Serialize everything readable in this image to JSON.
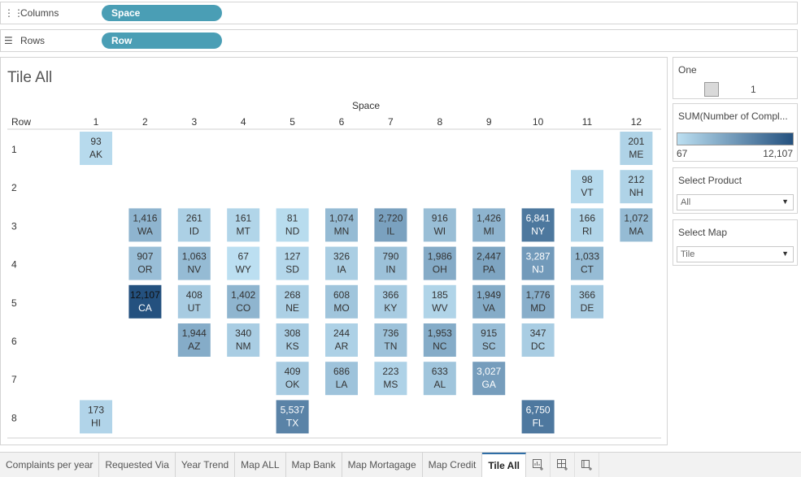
{
  "shelves": {
    "columns": {
      "label": "Columns",
      "pill": "Space"
    },
    "rows": {
      "label": "Rows",
      "pill": "Row"
    }
  },
  "view": {
    "title": "Tile All"
  },
  "legend_one": {
    "title": "One",
    "value": "1"
  },
  "color_legend": {
    "title": "SUM(Number of Compl...",
    "min": "67",
    "max": "12,107",
    "color_low": "#bcdff1",
    "color_high": "#24517f"
  },
  "select_product": {
    "title": "Select Product",
    "value": "All"
  },
  "select_map": {
    "title": "Select Map",
    "value": "Tile"
  },
  "tabs": [
    {
      "label": "Complaints per year",
      "active": false
    },
    {
      "label": "Requested Via",
      "active": false
    },
    {
      "label": "Year Trend",
      "active": false
    },
    {
      "label": "Map ALL",
      "active": false
    },
    {
      "label": "Map Bank",
      "active": false
    },
    {
      "label": "Map Mortagage",
      "active": false
    },
    {
      "label": "Map Credit",
      "active": false
    },
    {
      "label": "Tile All",
      "active": true
    }
  ],
  "tab_icons": [
    "new-worksheet-icon",
    "new-dashboard-icon",
    "new-story-icon"
  ],
  "chart_data": {
    "type": "heatmap",
    "xlabel": "Space",
    "ylabel": "Row",
    "x_categories": [
      "1",
      "2",
      "3",
      "4",
      "5",
      "6",
      "7",
      "8",
      "9",
      "10",
      "11",
      "12"
    ],
    "y_categories": [
      "1",
      "2",
      "3",
      "4",
      "5",
      "6",
      "7",
      "8"
    ],
    "color_range": [
      67,
      12107
    ],
    "tiles": [
      {
        "state": "AK",
        "col": 1,
        "row": 1,
        "value": 93
      },
      {
        "state": "ME",
        "col": 12,
        "row": 1,
        "value": 201
      },
      {
        "state": "VT",
        "col": 11,
        "row": 2,
        "value": 98
      },
      {
        "state": "NH",
        "col": 12,
        "row": 2,
        "value": 212
      },
      {
        "state": "WA",
        "col": 2,
        "row": 3,
        "value": 1416
      },
      {
        "state": "ID",
        "col": 3,
        "row": 3,
        "value": 261
      },
      {
        "state": "MT",
        "col": 4,
        "row": 3,
        "value": 161
      },
      {
        "state": "ND",
        "col": 5,
        "row": 3,
        "value": 81
      },
      {
        "state": "MN",
        "col": 6,
        "row": 3,
        "value": 1074
      },
      {
        "state": "IL",
        "col": 7,
        "row": 3,
        "value": 2720
      },
      {
        "state": "WI",
        "col": 8,
        "row": 3,
        "value": 916
      },
      {
        "state": "MI",
        "col": 9,
        "row": 3,
        "value": 1426
      },
      {
        "state": "NY",
        "col": 10,
        "row": 3,
        "value": 6841
      },
      {
        "state": "RI",
        "col": 11,
        "row": 3,
        "value": 166
      },
      {
        "state": "MA",
        "col": 12,
        "row": 3,
        "value": 1072
      },
      {
        "state": "OR",
        "col": 2,
        "row": 4,
        "value": 907
      },
      {
        "state": "NV",
        "col": 3,
        "row": 4,
        "value": 1063
      },
      {
        "state": "WY",
        "col": 4,
        "row": 4,
        "value": 67
      },
      {
        "state": "SD",
        "col": 5,
        "row": 4,
        "value": 127
      },
      {
        "state": "IA",
        "col": 6,
        "row": 4,
        "value": 326
      },
      {
        "state": "IN",
        "col": 7,
        "row": 4,
        "value": 790
      },
      {
        "state": "OH",
        "col": 8,
        "row": 4,
        "value": 1986
      },
      {
        "state": "PA",
        "col": 9,
        "row": 4,
        "value": 2447
      },
      {
        "state": "NJ",
        "col": 10,
        "row": 4,
        "value": 3287
      },
      {
        "state": "CT",
        "col": 11,
        "row": 4,
        "value": 1033
      },
      {
        "state": "CA",
        "col": 2,
        "row": 5,
        "value": 12107
      },
      {
        "state": "UT",
        "col": 3,
        "row": 5,
        "value": 408
      },
      {
        "state": "CO",
        "col": 4,
        "row": 5,
        "value": 1402
      },
      {
        "state": "NE",
        "col": 5,
        "row": 5,
        "value": 268
      },
      {
        "state": "MO",
        "col": 6,
        "row": 5,
        "value": 608
      },
      {
        "state": "KY",
        "col": 7,
        "row": 5,
        "value": 366
      },
      {
        "state": "WV",
        "col": 8,
        "row": 5,
        "value": 185
      },
      {
        "state": "VA",
        "col": 9,
        "row": 5,
        "value": 1949
      },
      {
        "state": "MD",
        "col": 10,
        "row": 5,
        "value": 1776
      },
      {
        "state": "DE",
        "col": 11,
        "row": 5,
        "value": 366
      },
      {
        "state": "AZ",
        "col": 3,
        "row": 6,
        "value": 1944
      },
      {
        "state": "NM",
        "col": 4,
        "row": 6,
        "value": 340
      },
      {
        "state": "KS",
        "col": 5,
        "row": 6,
        "value": 308
      },
      {
        "state": "AR",
        "col": 6,
        "row": 6,
        "value": 244
      },
      {
        "state": "TN",
        "col": 7,
        "row": 6,
        "value": 736
      },
      {
        "state": "NC",
        "col": 8,
        "row": 6,
        "value": 1953
      },
      {
        "state": "SC",
        "col": 9,
        "row": 6,
        "value": 915
      },
      {
        "state": "DC",
        "col": 10,
        "row": 6,
        "value": 347
      },
      {
        "state": "OK",
        "col": 5,
        "row": 7,
        "value": 409
      },
      {
        "state": "LA",
        "col": 6,
        "row": 7,
        "value": 686
      },
      {
        "state": "MS",
        "col": 7,
        "row": 7,
        "value": 223
      },
      {
        "state": "AL",
        "col": 8,
        "row": 7,
        "value": 633
      },
      {
        "state": "GA",
        "col": 9,
        "row": 7,
        "value": 3027
      },
      {
        "state": "HI",
        "col": 1,
        "row": 8,
        "value": 173
      },
      {
        "state": "TX",
        "col": 5,
        "row": 8,
        "value": 5537
      },
      {
        "state": "FL",
        "col": 10,
        "row": 8,
        "value": 6750
      }
    ]
  }
}
